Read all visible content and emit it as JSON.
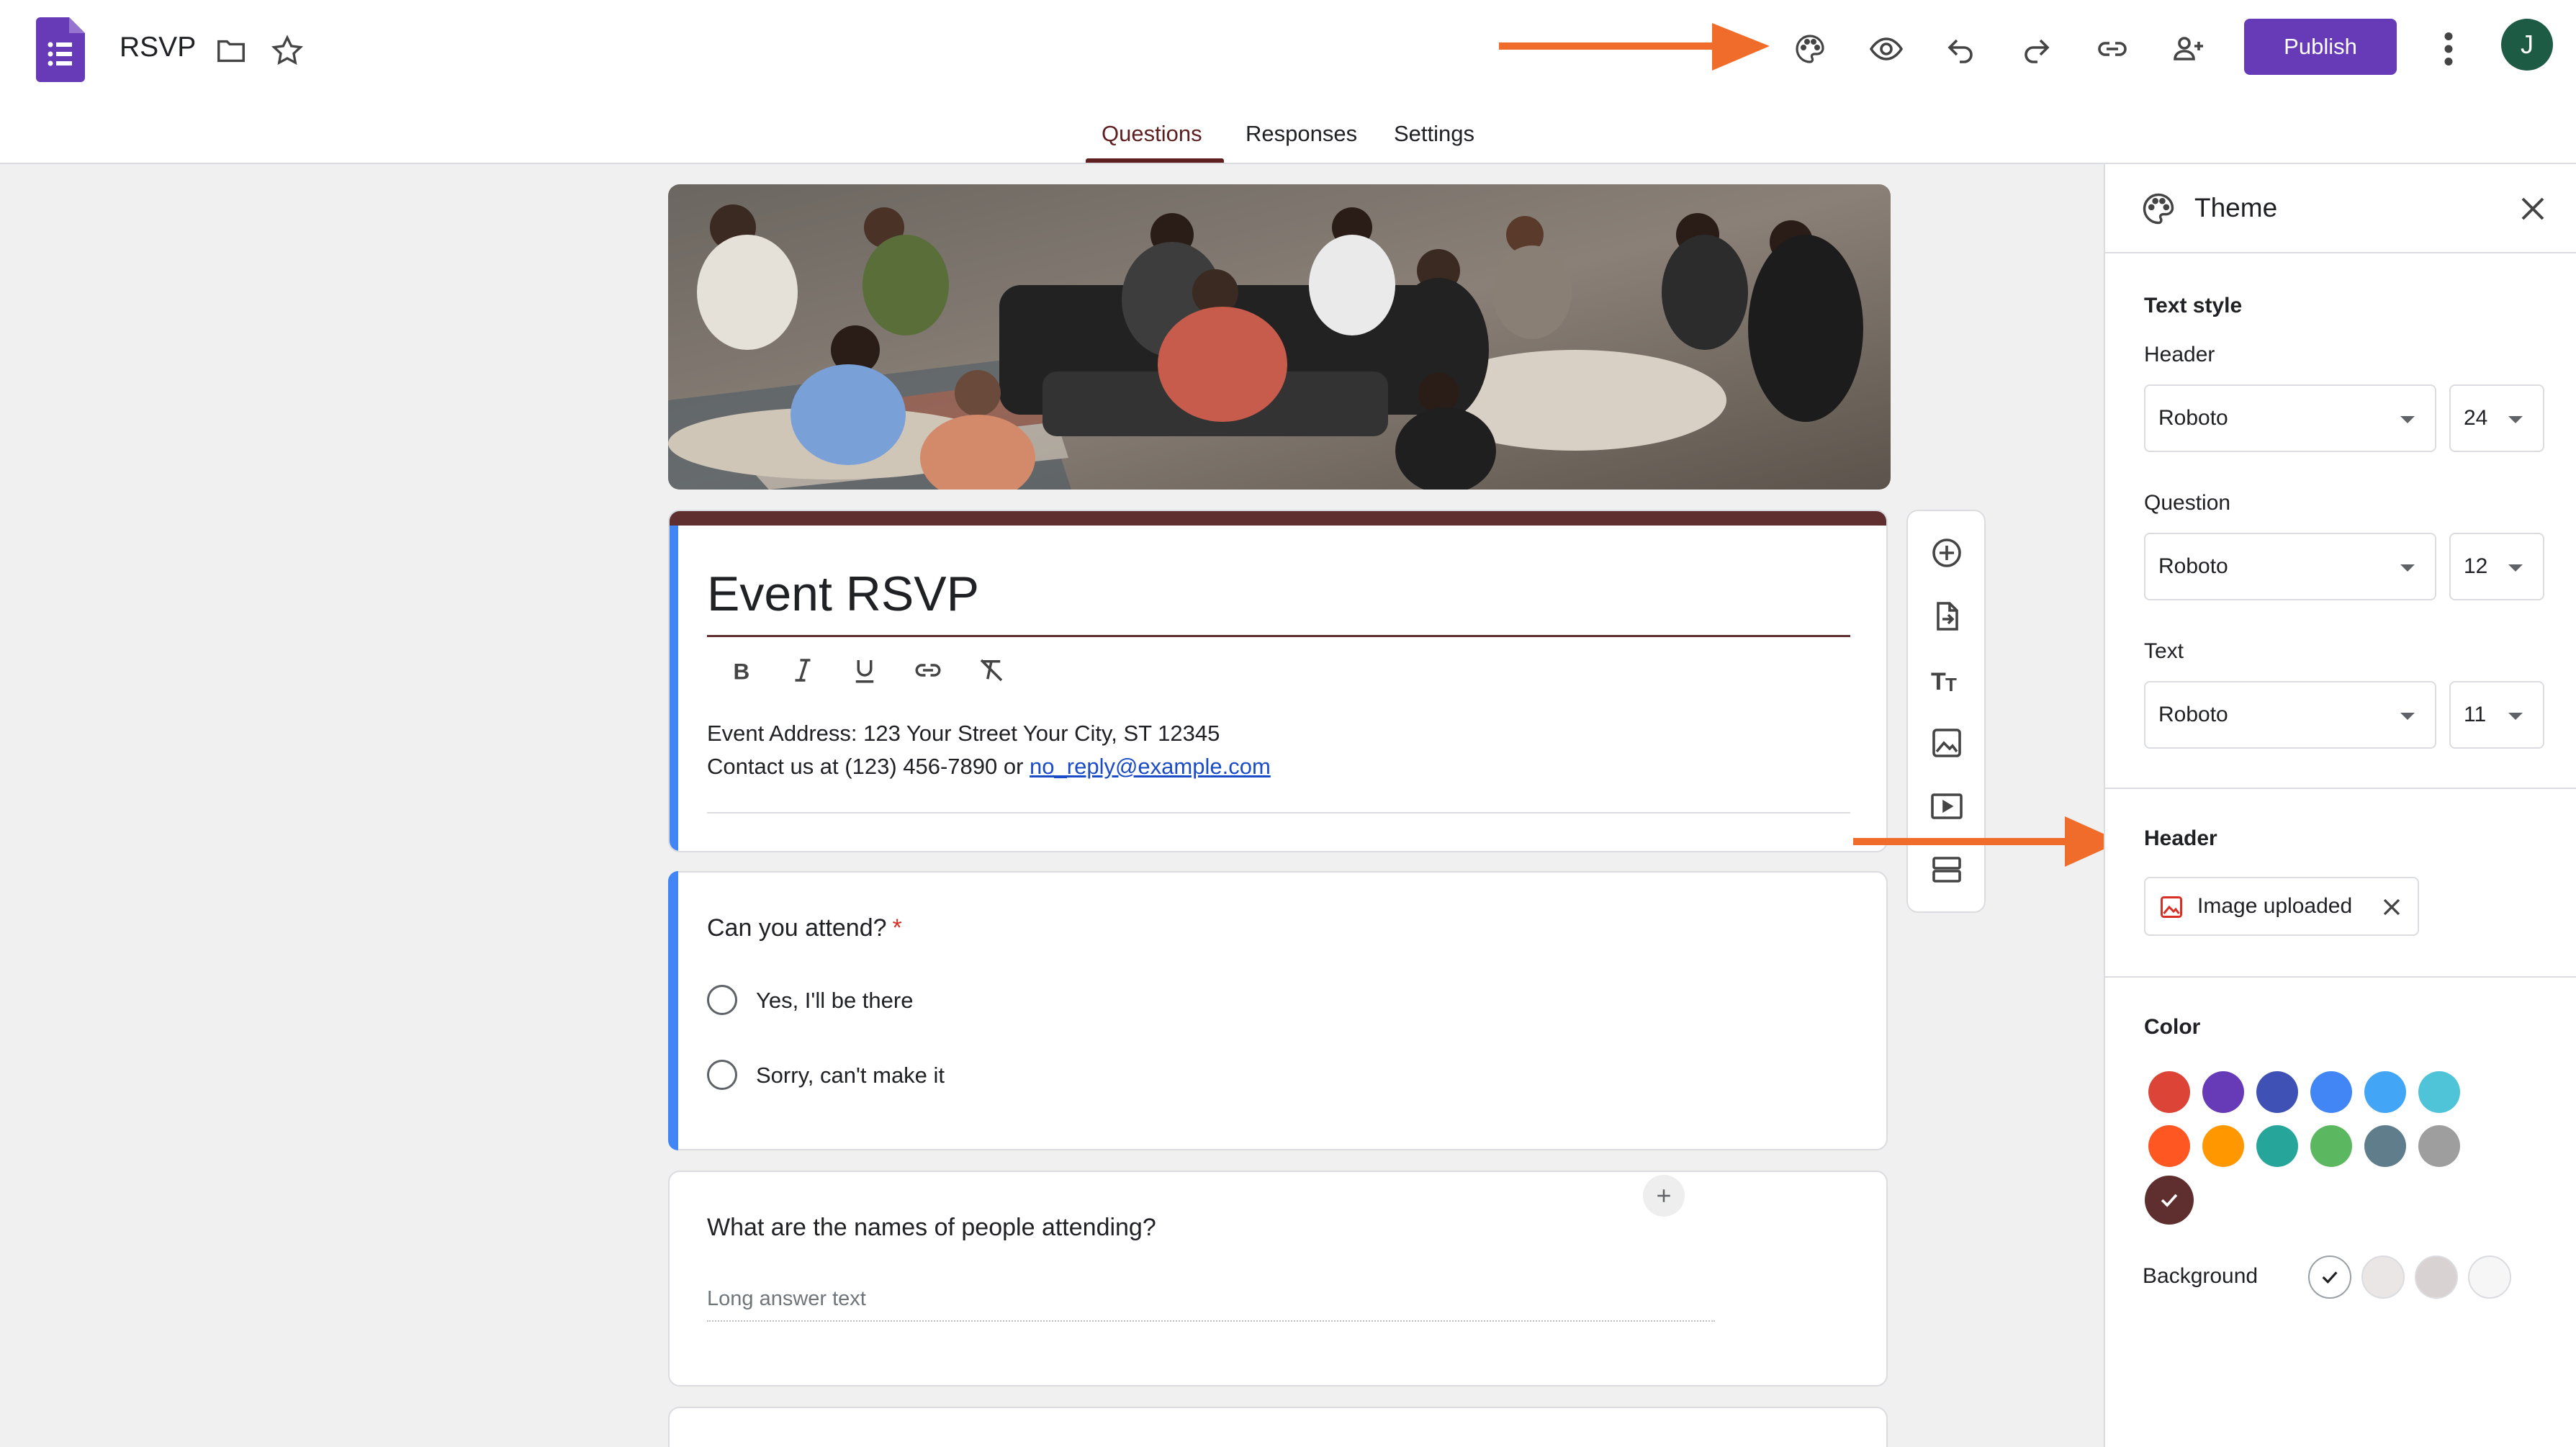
{
  "app": {
    "doc_title": "RSVP",
    "icons": [
      "forms-logo-icon",
      "folder-icon",
      "star-icon",
      "palette-icon",
      "preview-icon",
      "undo-icon",
      "redo-icon",
      "link-icon",
      "add-collaborator-icon",
      "more-vert-icon"
    ],
    "publish_label": "Publish",
    "avatar_initial": "J",
    "brand_color": "#673ab7"
  },
  "tabs": [
    {
      "label": "Questions",
      "active": true
    },
    {
      "label": "Responses",
      "active": false
    },
    {
      "label": "Settings",
      "active": false
    }
  ],
  "form": {
    "title": "Event RSVP",
    "description_line1": "Event Address: 123 Your Street Your City, ST 12345",
    "description_line2_prefix": "Contact us at (123) 456-7890 or ",
    "description_email": "no_reply@example.com",
    "theme_color": "#5f2e2e",
    "questions": [
      {
        "title": "Can you attend?",
        "required_mark": "*",
        "options": [
          "Yes,  I'll be there",
          "Sorry, can't make it"
        ]
      },
      {
        "title": "What are the names of people attending?",
        "placeholder": "Long answer text"
      }
    ]
  },
  "side_toolbar": {
    "icons": [
      "add-question-icon",
      "import-questions-icon",
      "add-title-icon",
      "add-image-icon",
      "add-video-icon",
      "add-section-icon"
    ]
  },
  "theme_panel": {
    "title": "Theme",
    "text_style_label": "Text style",
    "header_label": "Header",
    "header_font": "Roboto",
    "header_size": "24",
    "question_label": "Question",
    "question_font": "Roboto",
    "question_size": "12",
    "text_label": "Text",
    "text_font": "Roboto",
    "text_size": "11",
    "header_section_label": "Header",
    "header_image_chip": "Image uploaded",
    "color_label": "Color",
    "colors": [
      "#db4437",
      "#673ab7",
      "#3f51b5",
      "#4285f4",
      "#42a5f5",
      "#4fc3d7",
      "#ff5722",
      "#ff9800",
      "#26a69a",
      "#5cb860",
      "#607d8b",
      "#9e9e9e",
      "#5f2e2e"
    ],
    "selected_color": "#5f2e2e",
    "background_label": "Background",
    "backgrounds": [
      "#ffffff",
      "#ebe6e6",
      "#d8d2d2",
      "#f6f6f6"
    ]
  }
}
